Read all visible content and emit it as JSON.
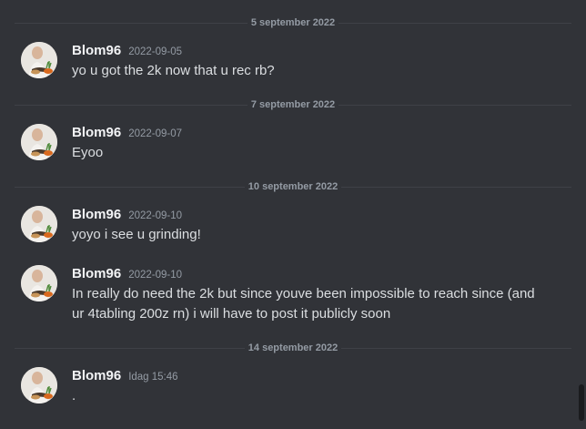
{
  "dividers": [
    {
      "label": "5 september 2022"
    },
    {
      "label": "7 september 2022"
    },
    {
      "label": "10 september 2022"
    },
    {
      "label": "14 september 2022"
    }
  ],
  "messages": [
    {
      "username": "Blom96",
      "timestamp": "2022-09-05",
      "text": "yo u got the 2k now that u rec rb?"
    },
    {
      "username": "Blom96",
      "timestamp": "2022-09-07",
      "text": "Eyoo"
    },
    {
      "username": "Blom96",
      "timestamp": "2022-09-10",
      "text": "yoyo i see u grinding!"
    },
    {
      "username": "Blom96",
      "timestamp": "2022-09-10",
      "text": "In really do need the 2k but since youve been impossible to reach since (and ur 4tabling 200z rn) i will have to post it publicly soon"
    },
    {
      "username": "Blom96",
      "timestamp": "Idag 15:46",
      "text": "."
    }
  ],
  "colors": {
    "background": "#313338",
    "username": "#f2f3f5",
    "message_text": "#dbdee1",
    "muted": "#949ba4",
    "divider_line": "#3f4147"
  }
}
